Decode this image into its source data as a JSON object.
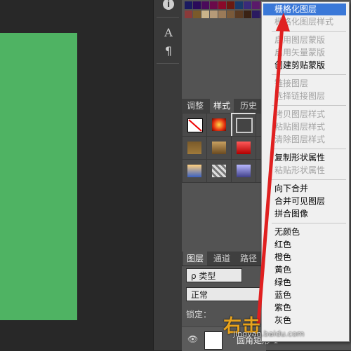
{
  "tools": {
    "character_label": "A",
    "paragraph_label": "¶",
    "info_label": "i"
  },
  "styles_panel": {
    "tabs": [
      "调整",
      "样式",
      "历史"
    ]
  },
  "layers_panel": {
    "tabs": [
      "图层",
      "通道",
      "路径"
    ],
    "kind_filter": "ρ 类型",
    "blend_mode": "正常",
    "lock_label": "锁定：",
    "layer_name": "圆角矩形 1"
  },
  "context_menu": {
    "items": [
      {
        "label": "栅格化图层",
        "state": "highlighted"
      },
      {
        "label": "栅格化图层样式",
        "state": "disabled"
      },
      {
        "label": "启用图层蒙版",
        "state": "disabled"
      },
      {
        "label": "启用矢量蒙版",
        "state": "disabled"
      },
      {
        "label": "创建剪贴蒙版",
        "state": "enabled"
      },
      {
        "label": "链接图层",
        "state": "disabled"
      },
      {
        "label": "选择链接图层",
        "state": "disabled"
      },
      {
        "label": "拷贝图层样式",
        "state": "disabled"
      },
      {
        "label": "粘贴图层样式",
        "state": "disabled"
      },
      {
        "label": "清除图层样式",
        "state": "disabled"
      },
      {
        "label": "复制形状属性",
        "state": "enabled"
      },
      {
        "label": "粘贴形状属性",
        "state": "disabled"
      },
      {
        "label": "向下合并",
        "state": "enabled"
      },
      {
        "label": "合并可见图层",
        "state": "enabled"
      },
      {
        "label": "拼合图像",
        "state": "enabled"
      },
      {
        "label": "无颜色",
        "state": "enabled"
      },
      {
        "label": "红色",
        "state": "enabled"
      },
      {
        "label": "橙色",
        "state": "enabled"
      },
      {
        "label": "黄色",
        "state": "enabled"
      },
      {
        "label": "绿色",
        "state": "enabled"
      },
      {
        "label": "蓝色",
        "state": "enabled"
      },
      {
        "label": "紫色",
        "state": "enabled"
      },
      {
        "label": "灰色",
        "state": "enabled"
      }
    ]
  },
  "annotation": {
    "text": "右击",
    "watermark": "jingyan.baidu.com"
  },
  "colors": {
    "canvas_shape": "#4fb363",
    "highlight": "#3a78d8",
    "arrow": "#e02020"
  }
}
